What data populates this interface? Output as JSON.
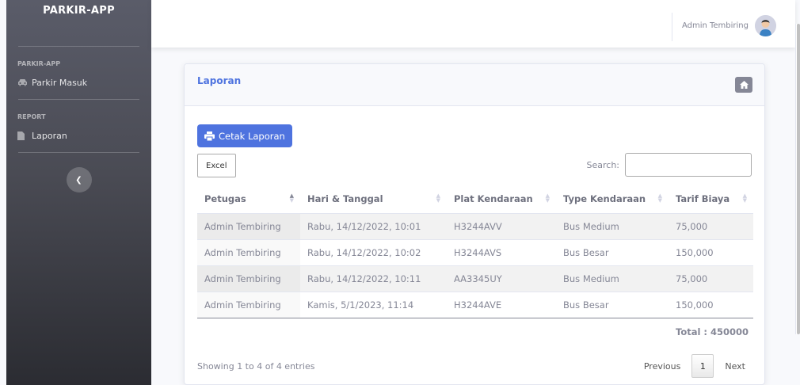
{
  "sidebar": {
    "brand": "PARKIR-APP",
    "section1_heading": "PARKIR-APP",
    "item_parkir_masuk": "Parkir Masuk",
    "section2_heading": "REPORT",
    "item_laporan": "Laporan"
  },
  "topbar": {
    "user_name": "Admin Tembiring"
  },
  "card": {
    "title": "Laporan",
    "print_label": "Cetak Laporan",
    "excel_label": "Excel",
    "search_label": "Search:",
    "search_value": ""
  },
  "table": {
    "headers": [
      "Petugas",
      "Hari & Tanggal",
      "Plat Kendaraan",
      "Type Kendaraan",
      "Tarif Biaya"
    ],
    "rows": [
      [
        "Admin Tembiring",
        "Rabu, 14/12/2022, 10:01",
        "H3244AVV",
        "Bus Medium",
        "75,000"
      ],
      [
        "Admin Tembiring",
        "Rabu, 14/12/2022, 10:02",
        "H3244AVS",
        "Bus Besar",
        "150,000"
      ],
      [
        "Admin Tembiring",
        "Rabu, 14/12/2022, 10:11",
        "AA3345UY",
        "Bus Medium",
        "75,000"
      ],
      [
        "Admin Tembiring",
        "Kamis, 5/1/2023, 11:14",
        "H3244AVE",
        "Bus Besar",
        "150,000"
      ]
    ],
    "total": "Total : 450000"
  },
  "footer": {
    "info": "Showing 1 to 4 of 4 entries",
    "previous": "Previous",
    "current_page": "1",
    "next": "Next"
  },
  "colors": {
    "primary": "#4e73df",
    "secondary": "#858796",
    "sidebar": "#5a5c69"
  },
  "icons": {
    "parkir_masuk": "car-icon",
    "laporan": "file-icon",
    "home": "home-icon",
    "print": "print-icon",
    "toggle": "chevron-left-icon"
  }
}
